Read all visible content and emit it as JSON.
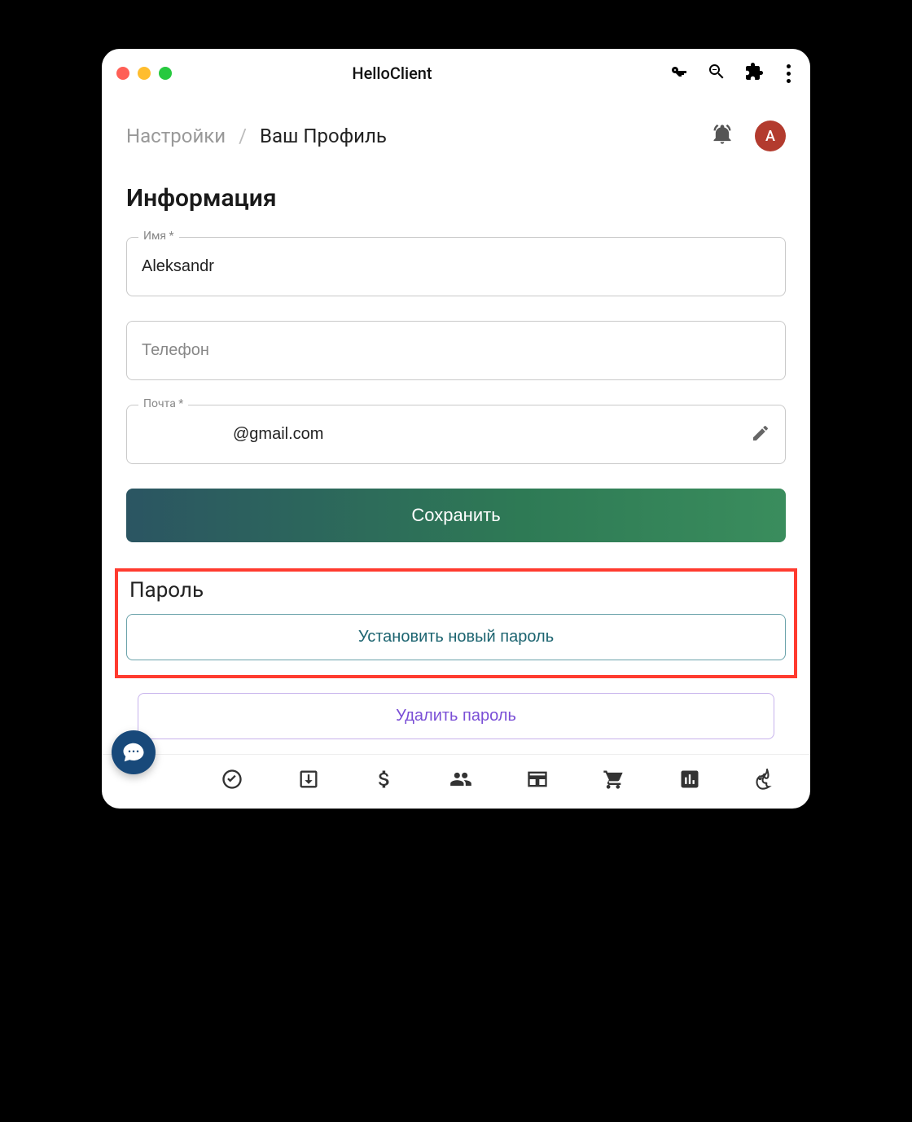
{
  "window": {
    "title": "HelloClient"
  },
  "breadcrumb": {
    "root": "Настройки",
    "sep": "/",
    "current": "Ваш Профиль"
  },
  "avatar": {
    "letter": "A"
  },
  "info": {
    "heading": "Информация",
    "name_label": "Имя *",
    "name_value": "Aleksandr",
    "phone_placeholder": "Телефон",
    "phone_value": "",
    "email_label": "Почта *",
    "email_value": "@gmail.com",
    "save_label": "Сохранить"
  },
  "password": {
    "heading": "Пароль",
    "set_new_label": "Установить новый пароль",
    "delete_label": "Удалить пароль"
  },
  "colors": {
    "highlight_border": "#ff3b2f",
    "avatar_bg": "#b33b2e",
    "teal": "#1c6470",
    "purple": "#7a4fd6"
  }
}
